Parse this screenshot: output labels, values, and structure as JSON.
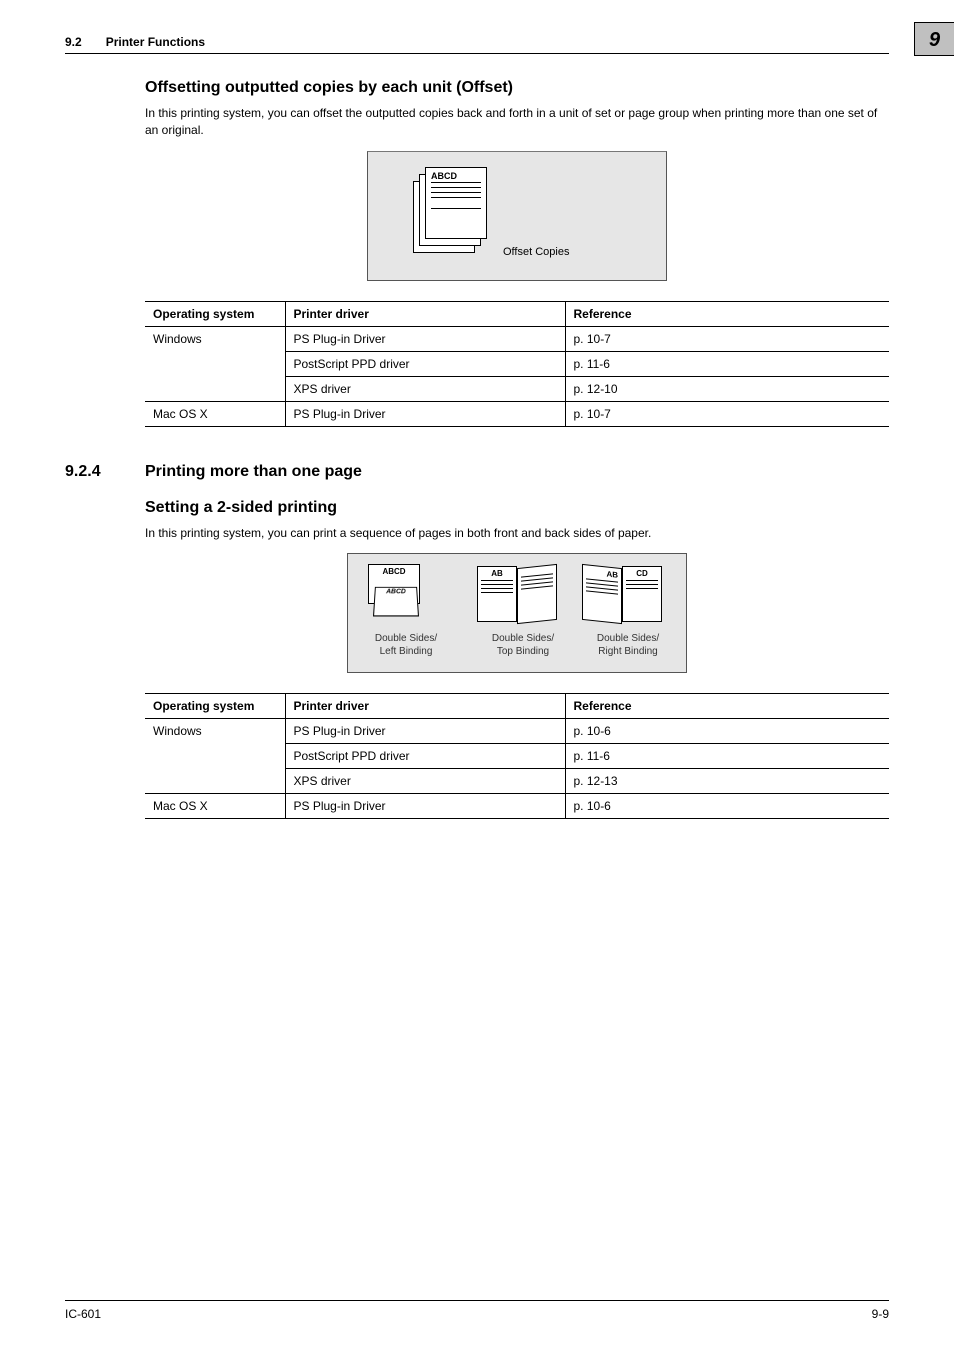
{
  "header": {
    "section_number": "9.2",
    "section_title": "Printer Functions",
    "chapter_number": "9"
  },
  "section1": {
    "heading": "Offsetting outputted copies by each unit (Offset)",
    "paragraph": "In this printing system, you can offset the outputted copies back and forth in a unit of set or page group when printing more than one set of an original.",
    "figure_page_label": "ABCD",
    "figure_caption": "Offset Copies"
  },
  "section2": {
    "number": "9.2.4",
    "heading": "Printing more than one page",
    "subheading": "Setting a 2-sided printing",
    "paragraph": "In this printing system, you can print a sequence of pages in both front and back sides of paper.",
    "duplex": {
      "label_abcd": "ABCD",
      "label_ab": "AB",
      "label_cd": "CD",
      "caption1_line1": "Double Sides/",
      "caption1_line2": "Left Binding",
      "caption2_line1": "Double Sides/",
      "caption2_line2": "Top Binding",
      "caption3_line1": "Double Sides/",
      "caption3_line2": "Right Binding"
    }
  },
  "table_headers": {
    "os": "Operating system",
    "driver": "Printer driver",
    "reference": "Reference"
  },
  "table1": {
    "rows": [
      {
        "os": "Windows",
        "driver": "PS Plug-in Driver",
        "reference": "p. 10-7"
      },
      {
        "os": "",
        "driver": "PostScript PPD driver",
        "reference": "p. 11-6"
      },
      {
        "os": "",
        "driver": "XPS driver",
        "reference": "p. 12-10"
      },
      {
        "os": "Mac OS X",
        "driver": "PS Plug-in Driver",
        "reference": "p. 10-7"
      }
    ]
  },
  "table2": {
    "rows": [
      {
        "os": "Windows",
        "driver": "PS Plug-in Driver",
        "reference": "p. 10-6"
      },
      {
        "os": "",
        "driver": "PostScript PPD driver",
        "reference": "p. 11-6"
      },
      {
        "os": "",
        "driver": "XPS driver",
        "reference": "p. 12-13"
      },
      {
        "os": "Mac OS X",
        "driver": "PS Plug-in Driver",
        "reference": "p. 10-6"
      }
    ]
  },
  "footer": {
    "left": "IC-601",
    "right": "9-9"
  }
}
